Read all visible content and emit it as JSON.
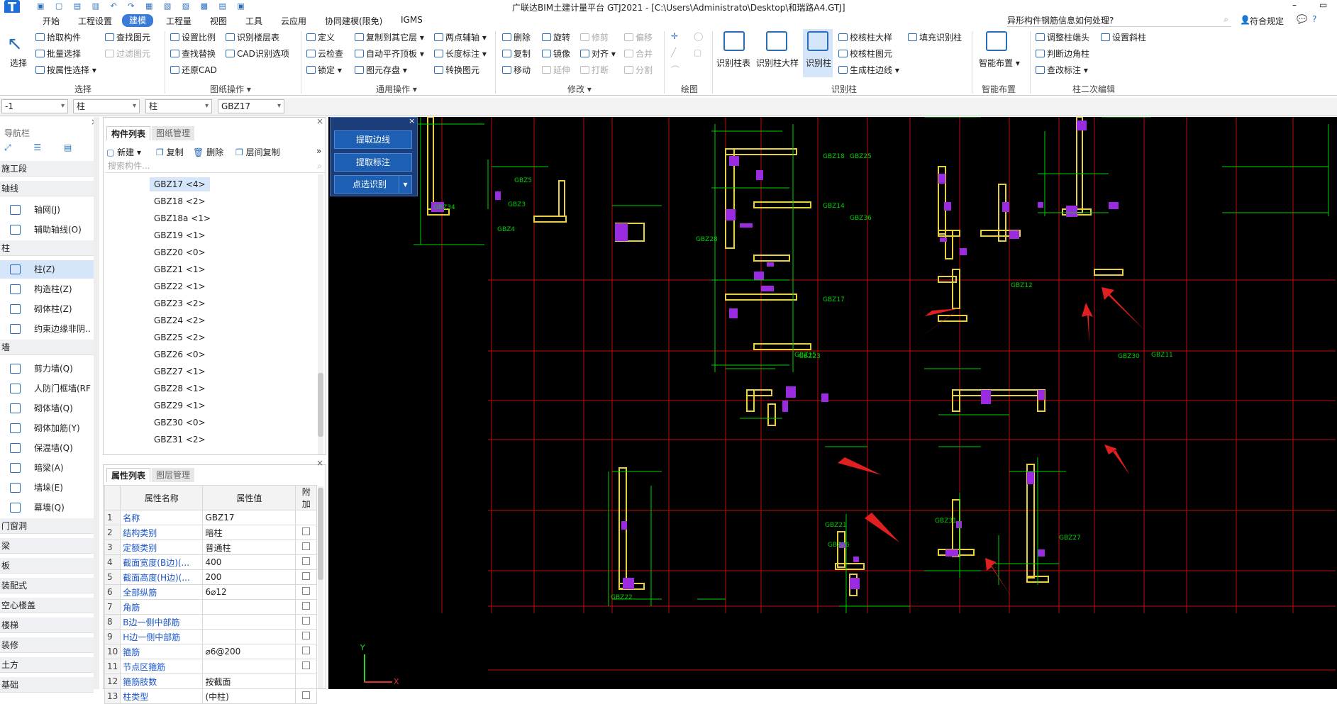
{
  "window": {
    "title": "广联达BIM土建计量平台 GTJ2021 - [C:\\Users\\Administrato\\Desktop\\和瑞路A4.GTJ]"
  },
  "search": {
    "placeholder": "异形构件钢筋信息如何处理?"
  },
  "user": {
    "label": "符合规定"
  },
  "menu": [
    "开始",
    "工程设置",
    "建模",
    "工程量",
    "视图",
    "工具",
    "云应用",
    "协同建模(限免)",
    "IGMS"
  ],
  "menu_active": "建模",
  "ribbon": {
    "select": {
      "big": "选择",
      "items": [
        "拾取构件",
        "批量选择",
        "按属性选择",
        "查找图元",
        "过滤图元"
      ],
      "group": "选择"
    },
    "drawing": {
      "items": [
        "设置比例",
        "识别楼层表",
        "查找替换",
        "CAD识别选项",
        "还原CAD"
      ],
      "group": "图纸操作"
    },
    "common": {
      "items": [
        "定义",
        "复制到其它层",
        "两点辅轴",
        "云检查",
        "自动平齐顶板",
        "长度标注",
        "锁定",
        "图元存盘",
        "转换图元"
      ],
      "group": "通用操作"
    },
    "modify": {
      "items": [
        "删除",
        "旋转",
        "修剪",
        "偏移",
        "复制",
        "镜像",
        "对齐",
        "合并",
        "移动",
        "延伸",
        "打断",
        "分割"
      ],
      "group": "修改"
    },
    "draw": {
      "group": "绘图"
    },
    "recog": {
      "items": [
        "识别柱表",
        "识别柱大样",
        "识别柱",
        "校核柱大样",
        "填充识别柱",
        "校核柱图元",
        "生成柱边线"
      ],
      "group": "识别柱"
    },
    "smart": {
      "big": "智能布置",
      "group": "智能布置"
    },
    "second": {
      "items": [
        "调整柱端头",
        "设置斜柱",
        "判断边角柱",
        "查改标注"
      ],
      "group": "柱二次编辑"
    }
  },
  "filters": [
    "-1",
    "柱",
    "柱",
    "GBZ17"
  ],
  "nav": {
    "title": "导航栏",
    "sections": [
      {
        "h": "施工段"
      },
      {
        "h": "轴线",
        "items": [
          "轴网(J)",
          "辅助轴线(O)"
        ]
      },
      {
        "h": "柱",
        "items": [
          "柱(Z)",
          "构造柱(Z)",
          "砌体柱(Z)",
          "约束边缘非阴.."
        ]
      },
      {
        "h": "墙",
        "items": [
          "剪力墙(Q)",
          "人防门框墙(RF",
          "砌体墙(Q)",
          "砌体加筋(Y)",
          "保温墙(Q)",
          "暗梁(A)",
          "墙垛(E)",
          "幕墙(Q)"
        ]
      },
      {
        "h": "门窗洞"
      },
      {
        "h": "梁"
      },
      {
        "h": "板"
      },
      {
        "h": "装配式"
      },
      {
        "h": "空心楼盖"
      },
      {
        "h": "楼梯"
      },
      {
        "h": "装修"
      },
      {
        "h": "土方"
      },
      {
        "h": "基础"
      }
    ],
    "active": "柱(Z)"
  },
  "components": {
    "tabs": [
      "构件列表",
      "图纸管理"
    ],
    "toolbar": [
      "新建",
      "复制",
      "删除",
      "层间复制"
    ],
    "search_placeholder": "搜索构件...",
    "items": [
      "GBZ17 <4>",
      "GBZ18 <2>",
      "GBZ18a <1>",
      "GBZ19 <1>",
      "GBZ20 <0>",
      "GBZ21 <1>",
      "GBZ22 <1>",
      "GBZ23 <2>",
      "GBZ24 <2>",
      "GBZ25 <2>",
      "GBZ26 <0>",
      "GBZ27 <1>",
      "GBZ28 <1>",
      "GBZ29 <1>",
      "GBZ30 <0>",
      "GBZ31 <2>"
    ],
    "selected": "GBZ17 <4>"
  },
  "properties": {
    "tabs": [
      "属性列表",
      "图层管理"
    ],
    "headers": [
      "属性名称",
      "属性值",
      "附加"
    ],
    "rows": [
      {
        "n": "1",
        "k": "名称",
        "v": "GBZ17",
        "cb": false
      },
      {
        "n": "2",
        "k": "结构类别",
        "v": "暗柱",
        "cb": true
      },
      {
        "n": "3",
        "k": "定额类别",
        "v": "普通柱",
        "cb": true
      },
      {
        "n": "4",
        "k": "截面宽度(B边)(...",
        "v": "400",
        "cb": true
      },
      {
        "n": "5",
        "k": "截面高度(H边)(...",
        "v": "200",
        "cb": true
      },
      {
        "n": "6",
        "k": "全部纵筋",
        "v": "6⌀12",
        "cb": true
      },
      {
        "n": "7",
        "k": "角筋",
        "v": "",
        "cb": true
      },
      {
        "n": "8",
        "k": "B边一侧中部筋",
        "v": "",
        "cb": true
      },
      {
        "n": "9",
        "k": "H边一侧中部筋",
        "v": "",
        "cb": true
      },
      {
        "n": "10",
        "k": "箍筋",
        "v": "⌀6@200",
        "cb": true
      },
      {
        "n": "11",
        "k": "节点区箍筋",
        "v": "",
        "cb": true
      },
      {
        "n": "12",
        "k": "箍筋肢数",
        "v": "按截面",
        "cb": false
      },
      {
        "n": "13",
        "k": "柱类型",
        "v": "(中柱)",
        "cb": true
      }
    ]
  },
  "float_panel": [
    "提取边线",
    "提取标注",
    "点选识别"
  ],
  "cad_labels": [
    "GBZ34",
    "GBZ3",
    "GBZ5",
    "GBZ4",
    "GBZ28",
    "GBZ18",
    "GBZ25",
    "GBZ14",
    "GBZ36",
    "GBZ17",
    "GBZ12",
    "GBZ15",
    "GBZ23",
    "GBZ30",
    "GBZ11",
    "GBZ22",
    "GBZ21",
    "GBZ26",
    "GBZ31",
    "GBZ27"
  ],
  "axis": {
    "x": "X",
    "y": "Y"
  },
  "colors": {
    "accent": "#3a7bd5",
    "canvas": "#000000",
    "grid": "#c01010",
    "dim": "#00d000",
    "column": "#e8d040",
    "rebar": "#9b2be0",
    "arrow": "#e02020"
  }
}
